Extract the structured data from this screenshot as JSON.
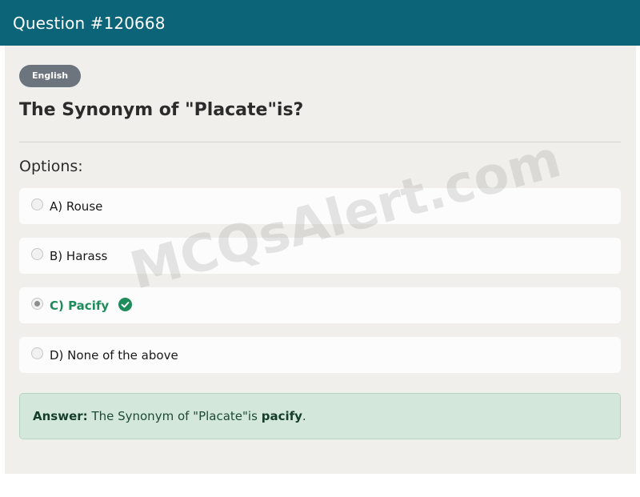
{
  "header": {
    "title": "Question #120668"
  },
  "badge": {
    "label": "English"
  },
  "question": {
    "text": "The Synonym of \"Placate\"is?"
  },
  "options_label": "Options:",
  "options": [
    {
      "label": "A) Rouse",
      "selected": false
    },
    {
      "label": "B) Harass",
      "selected": false
    },
    {
      "label": "C) Pacify",
      "selected": true,
      "correct": true
    },
    {
      "label": "D) None of the above",
      "selected": false
    }
  ],
  "answer": {
    "prefix": "Answer:",
    "text": "The Synonym of \"Placate\"is",
    "value": "pacify",
    "suffix": "."
  },
  "watermark": "MCQsAlert.com",
  "colors": {
    "header_bg": "#0b6478",
    "correct": "#1f8c5b",
    "answer_bg": "#d3e8db"
  },
  "icons": {
    "correct": "check-circle-icon"
  }
}
